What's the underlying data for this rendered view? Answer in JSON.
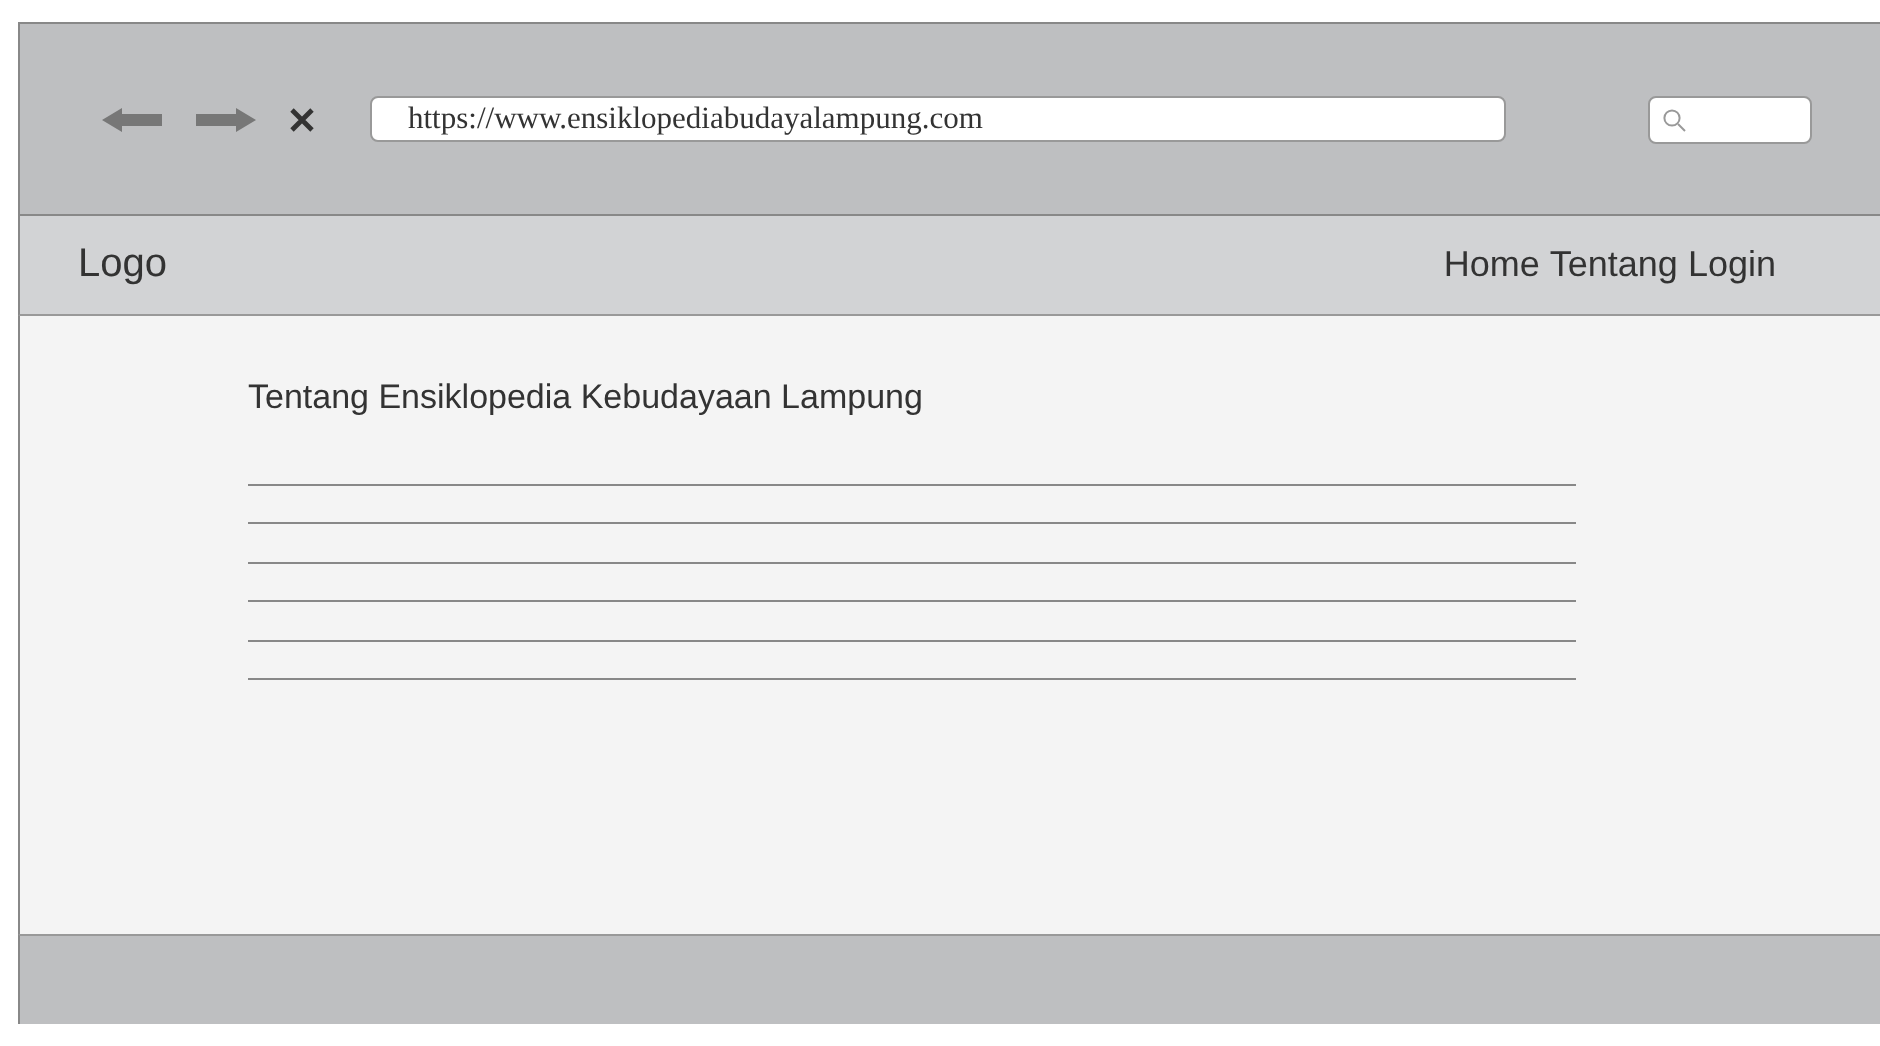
{
  "browser": {
    "toolbar": [
      {
        "kind": "back"
      },
      {
        "kind": "forward"
      },
      {
        "kind": "close"
      }
    ],
    "address": "https://www.ensiklopediabudayalampung.com",
    "search": {
      "kind": "search"
    }
  },
  "navbar": {
    "logo": "Logo",
    "links": [
      "Home",
      "Tentang",
      "Login"
    ]
  },
  "content": {
    "title": "Tentang Ensiklopedia Kebudayaan Lampung",
    "lines": [
      {
        "kind": "line"
      },
      {
        "kind": "line"
      },
      {
        "kind": "line"
      },
      {
        "kind": "line"
      },
      {
        "kind": "line"
      },
      {
        "kind": "line"
      }
    ]
  },
  "footer": {
    "kind": "bar"
  }
}
